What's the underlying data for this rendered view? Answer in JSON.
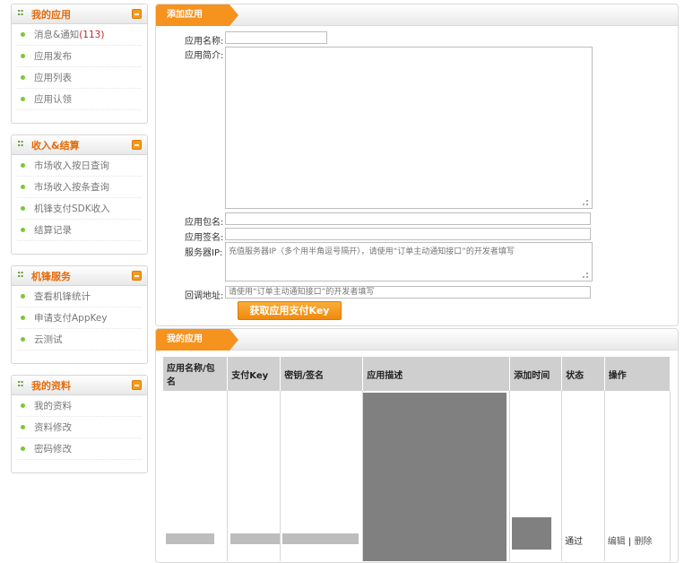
{
  "sidebar": {
    "panels": [
      {
        "title": "我的应用",
        "items": [
          {
            "label": "消息&通知",
            "count": "(113)"
          },
          {
            "label": "应用发布"
          },
          {
            "label": "应用列表"
          },
          {
            "label": "应用认领"
          }
        ]
      },
      {
        "title": "收入&结算",
        "items": [
          {
            "label": "市场收入按日查询"
          },
          {
            "label": "市场收入按条查询"
          },
          {
            "label": "机锋支付SDK收入"
          },
          {
            "label": "结算记录"
          }
        ]
      },
      {
        "title": "机锋服务",
        "items": [
          {
            "label": "查看机锋统计"
          },
          {
            "label": "申请支付AppKey"
          },
          {
            "label": "云测试"
          }
        ]
      },
      {
        "title": "我的资料",
        "items": [
          {
            "label": "我的资料"
          },
          {
            "label": "资料修改"
          },
          {
            "label": "密码修改"
          }
        ]
      }
    ]
  },
  "add_app": {
    "tab": "添加应用",
    "name_label": "应用名称:",
    "intro_label": "应用简介:",
    "package_label": "应用包名:",
    "signature_label": "应用签名:",
    "server_ip_label": "服务器IP:",
    "server_ip_placeholder": "充值服务器IP（多个用半角逗号隔开），请使用“订单主动通知接口”的开发者填写",
    "callback_label": "回调地址:",
    "callback_placeholder": "请使用“订单主动通知接口”的开发者填写",
    "submit_label": "获取应用支付Key"
  },
  "my_apps": {
    "tab": "我的应用",
    "columns": [
      "应用名称/包名",
      "支付Key",
      "密钥/签名",
      "应用描述",
      "添加时间",
      "状态",
      "操作"
    ],
    "rows": [
      {
        "status": "通过",
        "edit": "编辑",
        "sep": "|",
        "delete": "删除"
      }
    ]
  }
}
